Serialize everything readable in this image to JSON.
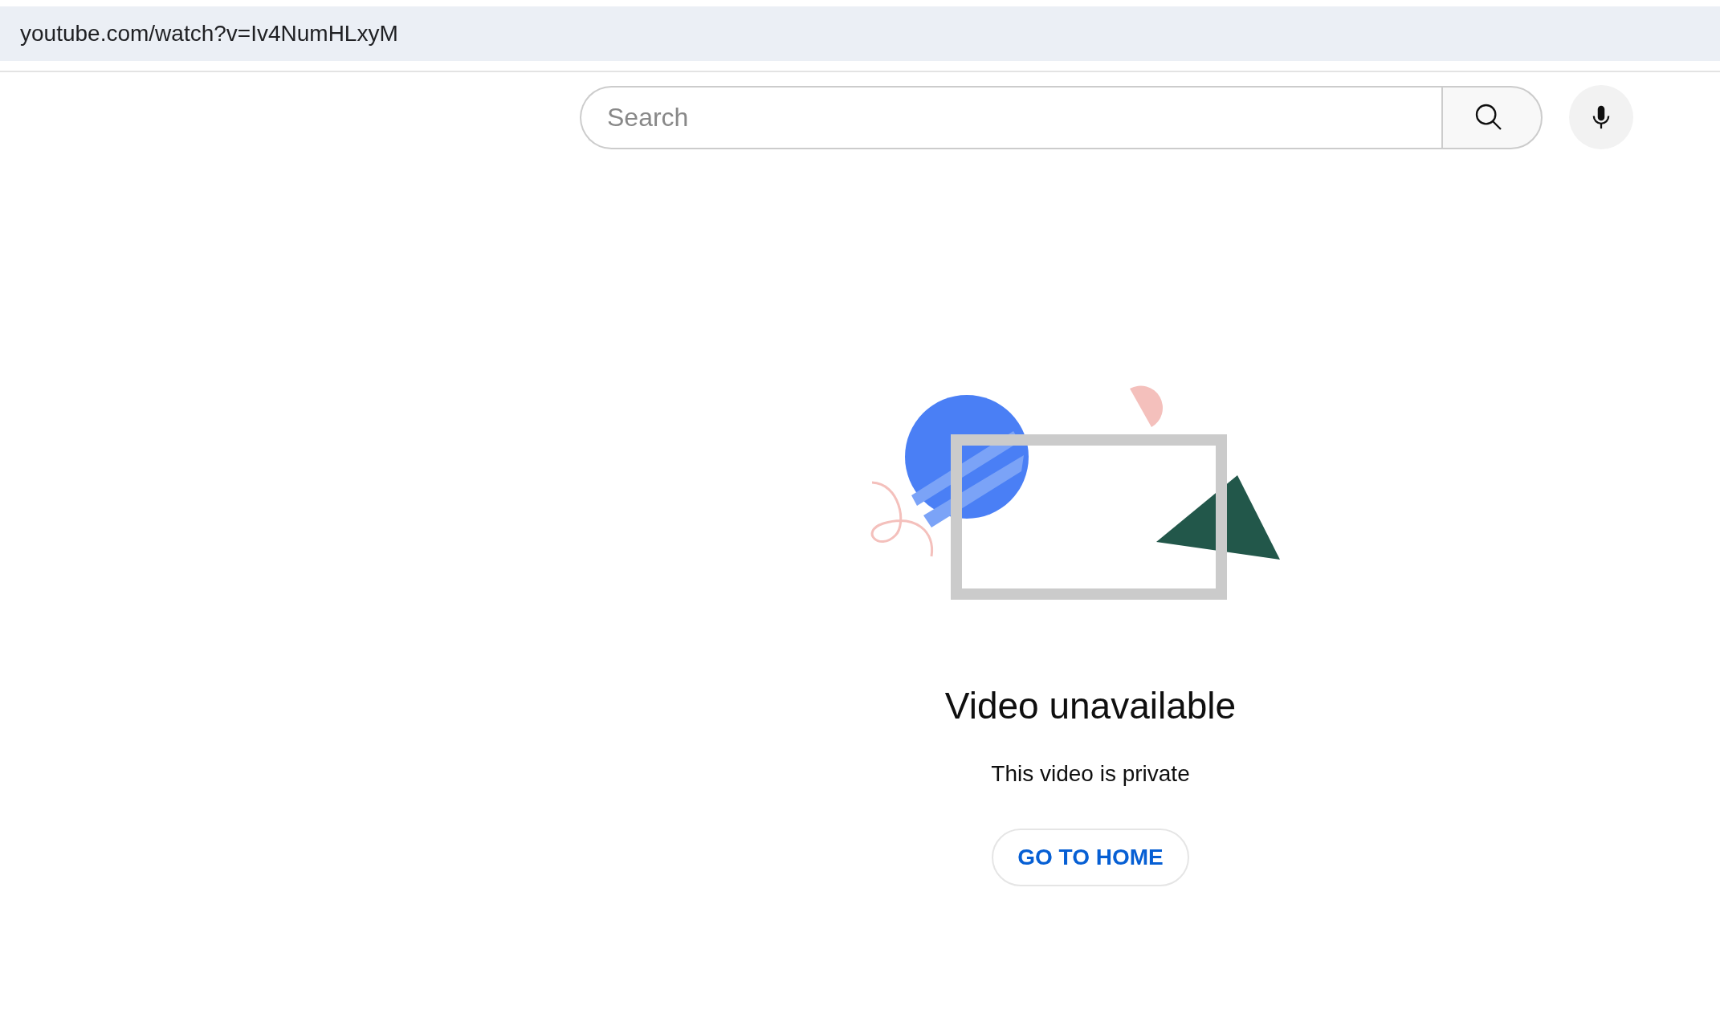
{
  "address_bar": {
    "url": "youtube.com/watch?v=Iv4NumHLxyM"
  },
  "search": {
    "placeholder": "Search"
  },
  "message": {
    "title": "Video unavailable",
    "subtitle": "This video is private"
  },
  "buttons": [
    {
      "label": "GO TO HOME"
    }
  ]
}
